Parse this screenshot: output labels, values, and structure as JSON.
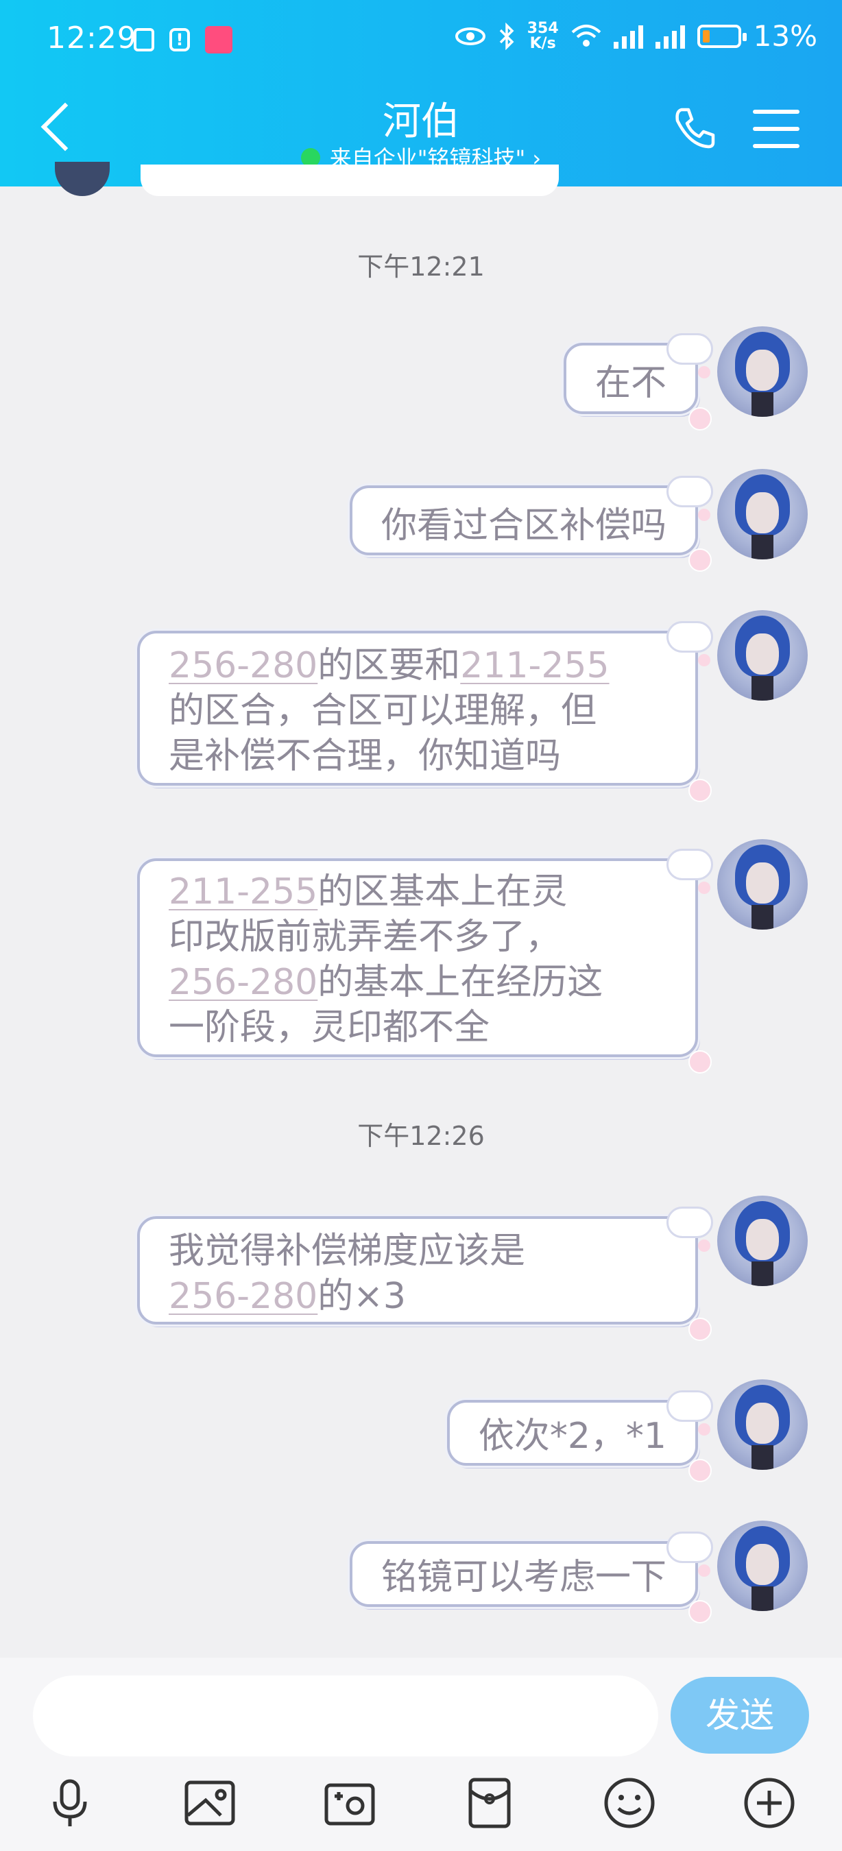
{
  "status_bar": {
    "time": "12:29",
    "net_speed": [
      "354",
      "K/s"
    ],
    "net_type": "4G",
    "battery_percent": "13%"
  },
  "header": {
    "title": "河伯",
    "subtitle": "来自企业\"铭镜科技\" ›",
    "accent": "#1ab4f3"
  },
  "chat": {
    "time_1": "下午12:21",
    "time_2": "下午12:26",
    "messages": [
      {
        "lines": [
          [
            {
              "t": "在不"
            }
          ]
        ]
      },
      {
        "lines": [
          [
            {
              "t": "你看过合区补偿吗"
            }
          ]
        ]
      },
      {
        "lines": [
          [
            {
              "t": "256-280",
              "link": true
            },
            {
              "t": "的区要和"
            },
            {
              "t": "211-255",
              "link": true
            }
          ],
          [
            {
              "t": "的区合，合区可以理解，但"
            }
          ],
          [
            {
              "t": "是补偿不合理，你知道吗"
            }
          ]
        ]
      },
      {
        "lines": [
          [
            {
              "t": "211-255",
              "link": true
            },
            {
              "t": "的区基本上在灵"
            }
          ],
          [
            {
              "t": "印改版前就弄差不多了，"
            }
          ],
          [
            {
              "t": "256-280",
              "link": true
            },
            {
              "t": "的基本上在经历这"
            }
          ],
          [
            {
              "t": "一阶段，灵印都不全"
            }
          ]
        ]
      },
      {
        "lines": [
          [
            {
              "t": "我觉得补偿梯度应该是"
            }
          ],
          [
            {
              "t": "256-280",
              "link": true
            },
            {
              "t": "的×3"
            }
          ]
        ]
      },
      {
        "lines": [
          [
            {
              "t": "依次*2，*1"
            }
          ]
        ]
      },
      {
        "lines": [
          [
            {
              "t": "铭镜可以考虑一下"
            }
          ]
        ]
      }
    ]
  },
  "input_bar": {
    "placeholder": "",
    "send_label": "发送"
  },
  "toolbar_icons": [
    "microphone-icon",
    "image-icon",
    "camera-icon",
    "red-packet-icon",
    "emoji-icon",
    "plus-icon"
  ]
}
